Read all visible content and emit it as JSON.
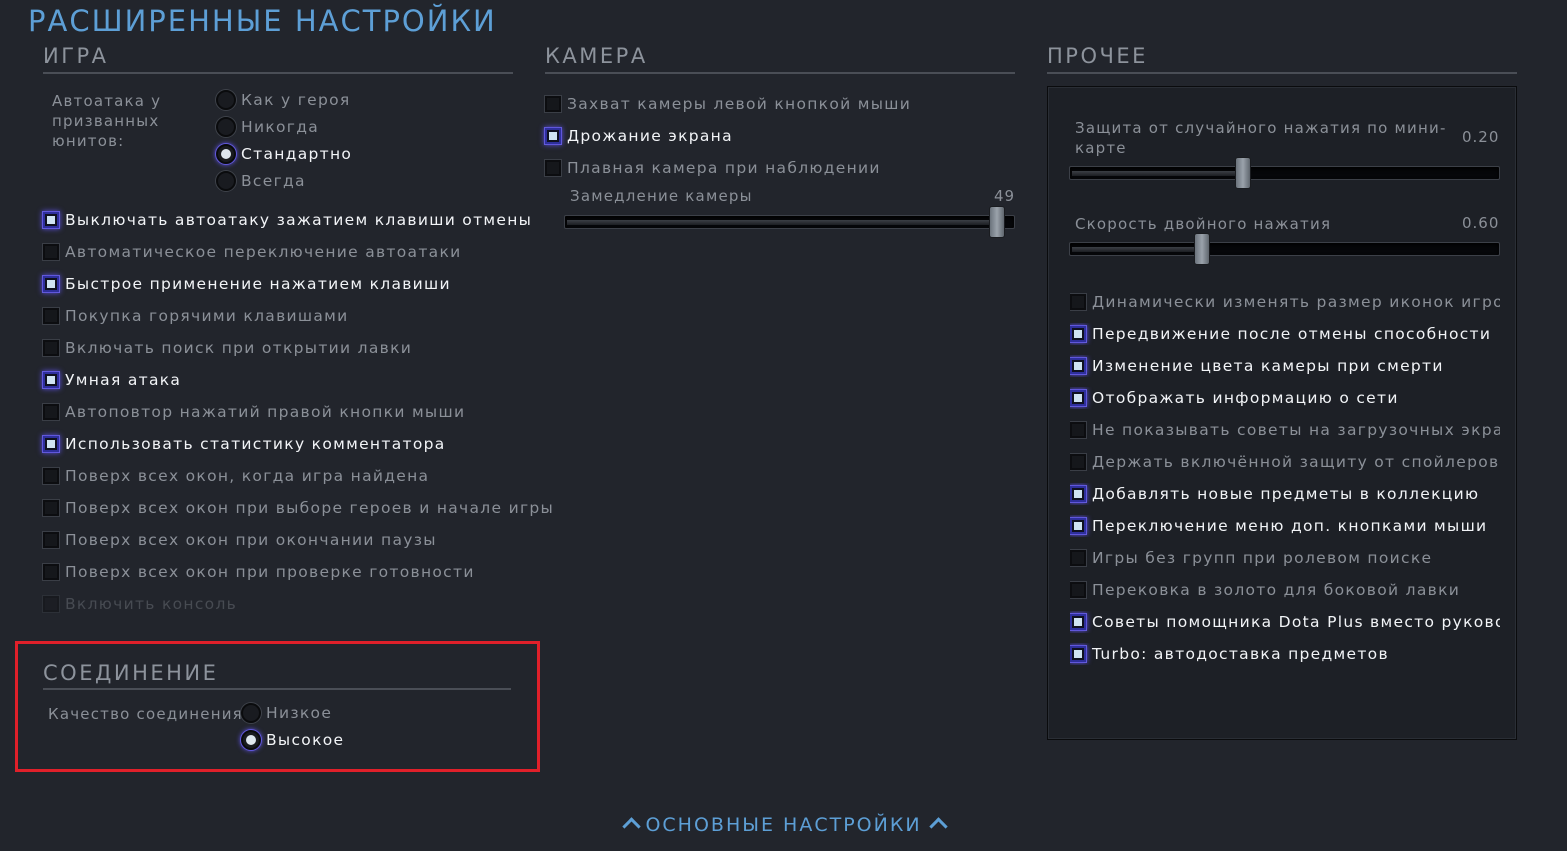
{
  "page_title": "РАСШИРЕННЫЕ НАСТРОЙКИ",
  "sections": {
    "game": "ИГРА",
    "camera": "КАМЕРА",
    "other": "ПРОЧЕЕ",
    "connection": "СОЕДИНЕНИЕ"
  },
  "game": {
    "autoattack_label_lines": [
      "Автоатака у",
      "призванных",
      "юнитов:"
    ],
    "autoattack_options": [
      {
        "label": "Как у героя",
        "selected": false
      },
      {
        "label": "Никогда",
        "selected": false
      },
      {
        "label": "Стандартно",
        "selected": true
      },
      {
        "label": "Всегда",
        "selected": false
      }
    ],
    "checkboxes": [
      {
        "label": "Выключать автоатаку зажатием клавиши отмены",
        "checked": true
      },
      {
        "label": "Автоматическое переключение автоатаки",
        "checked": false
      },
      {
        "label": "Быстрое применение нажатием клавиши",
        "checked": true
      },
      {
        "label": "Покупка горячими клавишами",
        "checked": false
      },
      {
        "label": "Включать поиск при открытии лавки",
        "checked": false
      },
      {
        "label": "Умная атака",
        "checked": true
      },
      {
        "label": "Автоповтор нажатий правой кнопки мыши",
        "checked": false
      },
      {
        "label": "Использовать статистику комментатора",
        "checked": true
      },
      {
        "label": "Поверх всех окон, когда игра найдена",
        "checked": false
      },
      {
        "label": "Поверх всех окон при выборе героев и начале игры",
        "checked": false
      },
      {
        "label": "Поверх всех окон при окончании паузы",
        "checked": false
      },
      {
        "label": "Поверх всех окон при проверке готовности",
        "checked": false
      },
      {
        "label": "Включить консоль",
        "checked": false,
        "disabled": true
      }
    ]
  },
  "camera": {
    "checkboxes": [
      {
        "label": "Захват камеры левой кнопкой мыши",
        "checked": false
      },
      {
        "label": "Дрожание экрана",
        "checked": true
      },
      {
        "label": "Плавная камера при наблюдении",
        "checked": false
      }
    ],
    "slowdown": {
      "label": "Замедление камеры",
      "value": "49",
      "fraction": 0.98
    }
  },
  "other": {
    "minimap_protect": {
      "label_lines": [
        "Защита от случайного нажатия по мини-",
        "карте"
      ],
      "value": "0.20",
      "fraction": 0.4
    },
    "double_tap": {
      "label": "Скорость двойного нажатия",
      "value": "0.60",
      "fraction": 0.3
    },
    "checkboxes": [
      {
        "label": "Динамически изменять размер иконок игроков",
        "checked": false
      },
      {
        "label": "Передвижение после отмены способности",
        "checked": true
      },
      {
        "label": "Изменение цвета камеры при смерти",
        "checked": true
      },
      {
        "label": "Отображать информацию о сети",
        "checked": true
      },
      {
        "label": "Не показывать советы на загрузочных экранах",
        "checked": false
      },
      {
        "label": "Держать включённой защиту от спойлеров",
        "checked": false
      },
      {
        "label": "Добавлять новые предметы в коллекцию",
        "checked": true
      },
      {
        "label": "Переключение меню доп. кнопками мыши",
        "checked": true
      },
      {
        "label": "Игры без групп при ролевом поиске",
        "checked": false
      },
      {
        "label": "Перековка в золото для боковой лавки",
        "checked": false
      },
      {
        "label": "Советы помощника Dota Plus вместо руководств",
        "checked": true
      },
      {
        "label": "Turbo: автодоставка предметов",
        "checked": true
      }
    ]
  },
  "connection": {
    "label": "Качество соединения:",
    "options": [
      {
        "label": "Низкое",
        "selected": false
      },
      {
        "label": "Высокое",
        "selected": true
      }
    ]
  },
  "footer": {
    "label": "ОСНОВНЫЕ НАСТРОЙКИ"
  },
  "colors": {
    "accent": "#5d9fd6",
    "highlight": "#e0202a",
    "background": "#22252c"
  }
}
